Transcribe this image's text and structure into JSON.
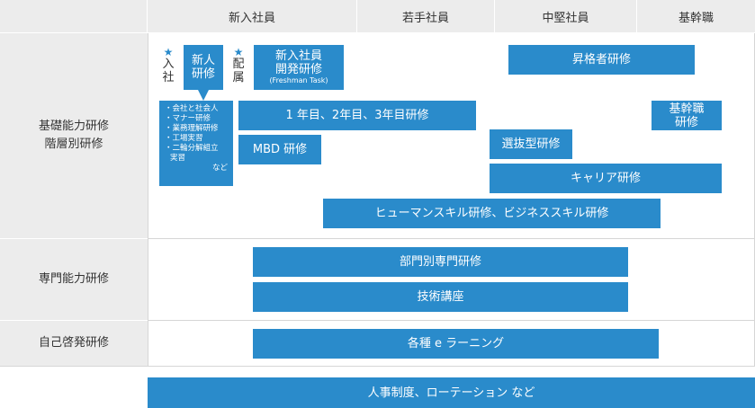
{
  "headers": {
    "new_employee": "新入社員",
    "young_employee": "若手社員",
    "mid_level": "中堅社員",
    "core_staff": "基幹職"
  },
  "rows": {
    "basic_line1": "基礎能力研修",
    "basic_line2": "階層別研修",
    "specialized": "専門能力研修",
    "self_development": "自己啓発研修"
  },
  "markers": {
    "star": "★",
    "entry_char1": "入",
    "entry_char2": "社",
    "assign_char1": "配",
    "assign_char2": "属"
  },
  "bars": {
    "newcomer_line1": "新人",
    "newcomer_line2": "研修",
    "freshman_line1": "新入社員",
    "freshman_line2": "開発研修",
    "freshman_sub": "(Freshman Task)",
    "promotion": "昇格者研修",
    "years": "1 年目、2年目、3年目研修",
    "core_line1": "基幹職",
    "core_line2": "研修",
    "mbd": "MBD 研修",
    "selective": "選抜型研修",
    "career": "キャリア研修",
    "human_business": "ヒューマンスキル研修、ビジネススキル研修",
    "department": "部門別専門研修",
    "technical": "技術講座",
    "elearning": "各種 e ラーニング",
    "hr_system": "人事制度、ローテーション など"
  },
  "newcomer_topics": {
    "items": [
      "・会社と社会人",
      "・マナー研修",
      "・業務理解研修",
      "・工場実習",
      "・二輪分解組立"
    ],
    "continuation": "実習",
    "etc": "など"
  },
  "colors": {
    "accent": "#2a8bcb",
    "header_bg": "#ececec",
    "grid": "#d6d6d6"
  }
}
